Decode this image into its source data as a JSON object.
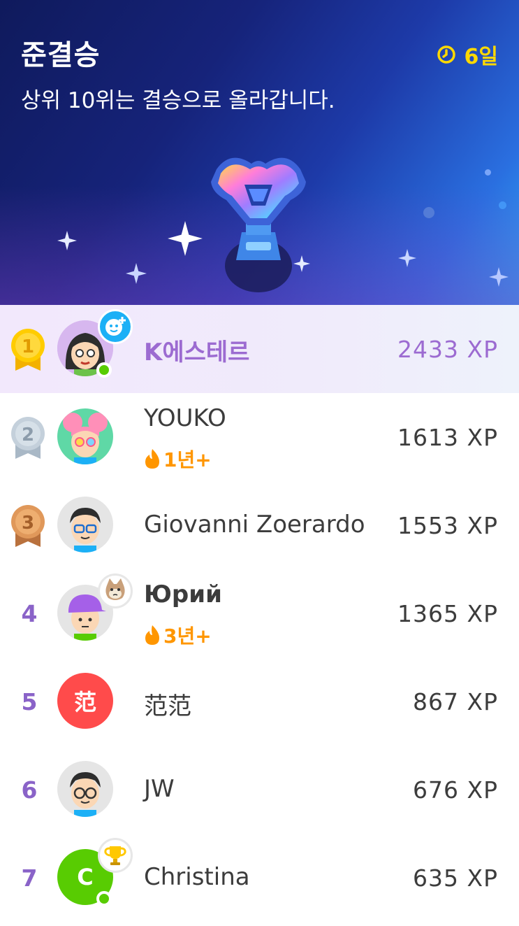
{
  "header": {
    "title": "준결승",
    "subtitle": "상위 10위는 결승으로 올라갑니다.",
    "timer": "6일",
    "timer_icon": "clock-icon",
    "trophy_icon": "semifinal-trophy-icon"
  },
  "colors": {
    "accent_purple": "#9c6bd1",
    "streak_orange": "#ff9600",
    "timer_yellow": "#ffd900",
    "online_green": "#58cc02"
  },
  "leaderboard": [
    {
      "rank": "1",
      "name": "K에스테르",
      "xp": "2433 XP",
      "medal": "gold",
      "current_user": true,
      "badge": "add-friend-icon",
      "online": true
    },
    {
      "rank": "2",
      "name": "YOUKO",
      "xp": "1613 XP",
      "medal": "silver",
      "streak": "1년+"
    },
    {
      "rank": "3",
      "name": "Giovanni Zoerardo",
      "xp": "1553 XP",
      "medal": "bronze"
    },
    {
      "rank": "4",
      "name": "Юрий",
      "xp": "1365 XP",
      "streak": "3년+",
      "badge": "cat-icon"
    },
    {
      "rank": "5",
      "name": "范范",
      "xp": "867 XP",
      "avatar_text": "范"
    },
    {
      "rank": "6",
      "name": "JW",
      "xp": "676 XP"
    },
    {
      "rank": "7",
      "name": "Christina",
      "xp": "635 XP",
      "avatar_text": "C",
      "badge": "trophy-icon",
      "online": true
    }
  ]
}
